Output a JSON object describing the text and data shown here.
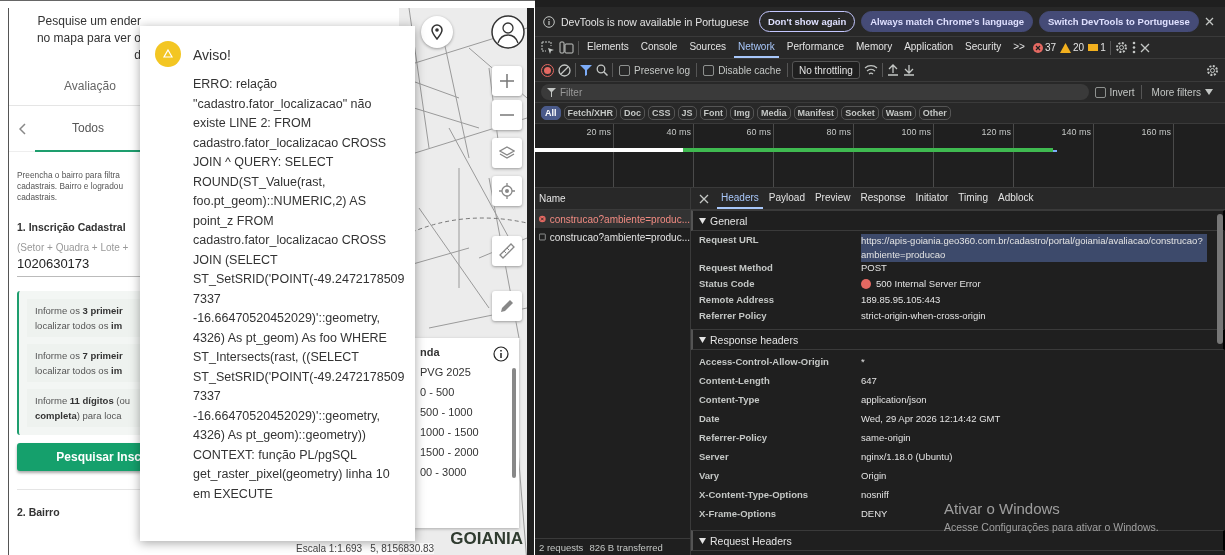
{
  "left_panel": {
    "intro_lines": [
      "Pesquise um ender",
      "no mapa para ver o",
      "d"
    ],
    "tabs": [
      {
        "label": "Avaliação",
        "selected": false
      }
    ],
    "subtabs": [
      {
        "label": "Todos",
        "selected": true
      }
    ],
    "description_lines": [
      "Preencha o bairro para filtra",
      "cadastrais. Bairro e logradou",
      "cadastrais."
    ],
    "inscricao": {
      "title": "1. Inscrição Cadastral",
      "hint": "(Setor + Quadra + Lote +",
      "value": "1020630173"
    },
    "tips": [
      {
        "lines": [
          "Informe os **3 primeir**",
          "localizar todos os **im**"
        ]
      },
      {
        "lines": [
          "Informe os **7 primeir**",
          "localizar todos os **im**"
        ]
      },
      {
        "lines": [
          "Informe **11 dígitos** (ou",
          "**completa**) para loca"
        ]
      }
    ],
    "search_button": "Pesquisar Insc",
    "next_section": "2. Bairro"
  },
  "dialog": {
    "kind": "warning",
    "title": "Aviso!",
    "message": "ERRO: relação \"cadastro.fator_localizacao\" não existe LINE 2: FROM cadastro.fator_localizacao CROSS JOIN ^ QUERY: SELECT ROUND(ST_Value(rast, foo.pt_geom)::NUMERIC,2) AS point_z FROM cadastro.fator_localizacao CROSS JOIN (SELECT ST_SetSRID('POINT(-49.24721785097337 -16.66470520452029)'::geometry, 4326) As pt_geom) As foo WHERE ST_Intersects(rast, ((SELECT ST_SetSRID('POINT(-49.24721785097337 -16.66470520452029)'::geometry, 4326) As pt_geom)::geometry)) CONTEXT: função PL/pgSQL get_raster_pixel(geometry) linha 10 em EXECUTE"
  },
  "map": {
    "legend": {
      "title": "nda",
      "subtitle": "PVG 2025",
      "items": [
        "0 - 500",
        "500 - 1000",
        "1000 - 1500",
        "1500 - 2000",
        "00 - 3000"
      ]
    },
    "scale": "Escala 1:1.693",
    "coordinates": "5, 8156830.83",
    "logo": "GOIANIA"
  },
  "devtools": {
    "banner": {
      "message": "DevTools is now available in Portuguese",
      "buttons": [
        {
          "label": "Don't show again",
          "kind": "outline"
        },
        {
          "label": "Always match Chrome's language",
          "kind": "filled"
        },
        {
          "label": "Switch DevTools to Portuguese",
          "kind": "filled"
        }
      ]
    },
    "panel_tabs": [
      {
        "label": "Elements",
        "selected": false
      },
      {
        "label": "Console",
        "selected": false
      },
      {
        "label": "Sources",
        "selected": false
      },
      {
        "label": "Network",
        "selected": true
      },
      {
        "label": "Performance",
        "selected": false
      },
      {
        "label": "Memory",
        "selected": false
      },
      {
        "label": "Application",
        "selected": false
      },
      {
        "label": "Security",
        "selected": false
      }
    ],
    "more_tabs": ">>",
    "counts": {
      "errors": "37",
      "warnings": "20",
      "issues": "1"
    },
    "toolbar": {
      "options": [
        {
          "label": "Preserve log",
          "checked": false
        },
        {
          "label": "Disable cache",
          "checked": false
        }
      ],
      "throttling": "No throttling"
    },
    "filter": {
      "placeholder": "Filter",
      "invert": {
        "label": "Invert",
        "checked": false
      },
      "more_filters": "More filters"
    },
    "type_filters": [
      {
        "label": "All",
        "selected": true
      },
      {
        "label": "Fetch/XHR",
        "selected": false
      },
      {
        "label": "Doc",
        "selected": false
      },
      {
        "label": "CSS",
        "selected": false
      },
      {
        "label": "JS",
        "selected": false
      },
      {
        "label": "Font",
        "selected": false
      },
      {
        "label": "Img",
        "selected": false
      },
      {
        "label": "Media",
        "selected": false
      },
      {
        "label": "Manifest",
        "selected": false
      },
      {
        "label": "Socket",
        "selected": false
      },
      {
        "label": "Wasm",
        "selected": false
      },
      {
        "label": "Other",
        "selected": false
      }
    ],
    "timeline": {
      "ticks": [
        "20 ms",
        "40 ms",
        "60 ms",
        "80 ms",
        "100 ms",
        "120 ms",
        "140 ms",
        "160 ms"
      ]
    },
    "requests": {
      "header": "Name",
      "rows": [
        {
          "name": "construcao?ambiente=produc...",
          "kind": "error",
          "selected": true
        },
        {
          "name": "construcao?ambiente=produc...",
          "kind": "ok",
          "selected": false
        }
      ],
      "summary": [
        "2 requests",
        "826 B transferred"
      ]
    },
    "detail_tabs": [
      {
        "label": "Headers",
        "selected": true
      },
      {
        "label": "Payload",
        "selected": false
      },
      {
        "label": "Preview",
        "selected": false
      },
      {
        "label": "Response",
        "selected": false
      },
      {
        "label": "Initiator",
        "selected": false
      },
      {
        "label": "Timing",
        "selected": false
      },
      {
        "label": "Adblock",
        "selected": false
      }
    ],
    "sections": [
      {
        "title": "General",
        "expanded": true,
        "kind": "compact",
        "rows": [
          {
            "name": "Request URL",
            "value": "https://apis-goiania.geo360.com.br/cadastro/portal/goiania/avaliacao/construcao?ambiente=producao",
            "kind": "url"
          },
          {
            "name": "Request Method",
            "value": "POST",
            "kind": "text"
          },
          {
            "name": "Status Code",
            "value": "500 Internal Server Error",
            "kind": "status",
            "color": "#e46962"
          },
          {
            "name": "Remote Address",
            "value": "189.85.95.105:443",
            "kind": "text"
          },
          {
            "name": "Referrer Policy",
            "value": "strict-origin-when-cross-origin",
            "kind": "text"
          }
        ]
      },
      {
        "title": "Response headers",
        "expanded": true,
        "kind": "spaced",
        "rows": [
          {
            "name": "Access-Control-Allow-Origin",
            "value": "*",
            "kind": "text"
          },
          {
            "name": "Content-Length",
            "value": "647",
            "kind": "text"
          },
          {
            "name": "Content-Type",
            "value": "application/json",
            "kind": "text"
          },
          {
            "name": "Date",
            "value": "Wed, 29 Apr 2026 12:14:42 GMT",
            "kind": "text"
          },
          {
            "name": "Referrer-Policy",
            "value": "same-origin",
            "kind": "text"
          },
          {
            "name": "Server",
            "value": "nginx/1.18.0 (Ubuntu)",
            "kind": "text"
          },
          {
            "name": "Vary",
            "value": "Origin",
            "kind": "text"
          },
          {
            "name": "X-Content-Type-Options",
            "value": "nosniff",
            "kind": "text"
          },
          {
            "name": "X-Frame-Options",
            "value": "DENY",
            "kind": "text"
          }
        ]
      },
      {
        "title": "Request Headers",
        "expanded": true
      }
    ],
    "os_notice": {
      "title": "Ativar o Windows",
      "text": "Acesse Configurações para ativar o Windows."
    }
  }
}
